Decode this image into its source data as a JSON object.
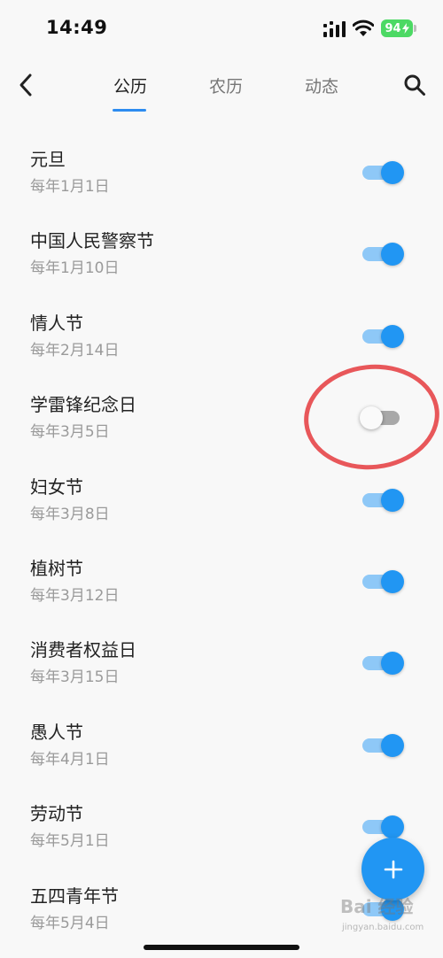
{
  "status_bar": {
    "time": "14:49",
    "battery": "94"
  },
  "header": {
    "back_icon": "chevron-left-icon",
    "tabs": [
      {
        "label": "公历",
        "active": true
      },
      {
        "label": "农历",
        "active": false
      },
      {
        "label": "动态",
        "active": false
      }
    ],
    "search_icon": "search-icon"
  },
  "holidays": [
    {
      "name": "元旦",
      "date": "每年1月1日",
      "enabled": true
    },
    {
      "name": "中国人民警察节",
      "date": "每年1月10日",
      "enabled": true
    },
    {
      "name": "情人节",
      "date": "每年2月14日",
      "enabled": true
    },
    {
      "name": "学雷锋纪念日",
      "date": "每年3月5日",
      "enabled": false
    },
    {
      "name": "妇女节",
      "date": "每年3月8日",
      "enabled": true
    },
    {
      "name": "植树节",
      "date": "每年3月12日",
      "enabled": true
    },
    {
      "name": "消费者权益日",
      "date": "每年3月15日",
      "enabled": true
    },
    {
      "name": "愚人节",
      "date": "每年4月1日",
      "enabled": true
    },
    {
      "name": "劳动节",
      "date": "每年5月1日",
      "enabled": true
    },
    {
      "name": "五四青年节",
      "date": "每年5月4日",
      "enabled": true
    }
  ],
  "fab": {
    "icon": "plus-icon"
  },
  "watermark": {
    "text": "Bai 经验",
    "sub": "jingyan.baidu.com"
  },
  "colors": {
    "accent": "#2196f3",
    "track_on": "#8ec8f7",
    "track_off": "#a8a8a8",
    "annotation": "#e8575a",
    "battery": "#4cd964"
  }
}
